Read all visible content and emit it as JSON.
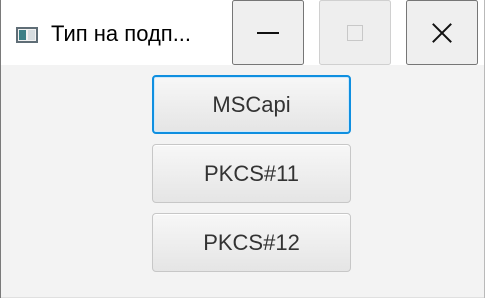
{
  "window": {
    "title": "Тип на подп...",
    "controls": {
      "minimize_icon": "minimize-icon",
      "maximize_icon": "maximize-icon",
      "close_icon": "close-icon"
    }
  },
  "app_icon": "java-window-icon",
  "buttons": {
    "mscapi_label": "MSCapi",
    "pkcs11_label": "PKCS#11",
    "pkcs12_label": "PKCS#12"
  },
  "colors": {
    "focus_border": "#0f8fe0",
    "button_background": "#eeeeee",
    "window_background": "#f3f3f3",
    "titlebar_background": "#ffffff"
  }
}
